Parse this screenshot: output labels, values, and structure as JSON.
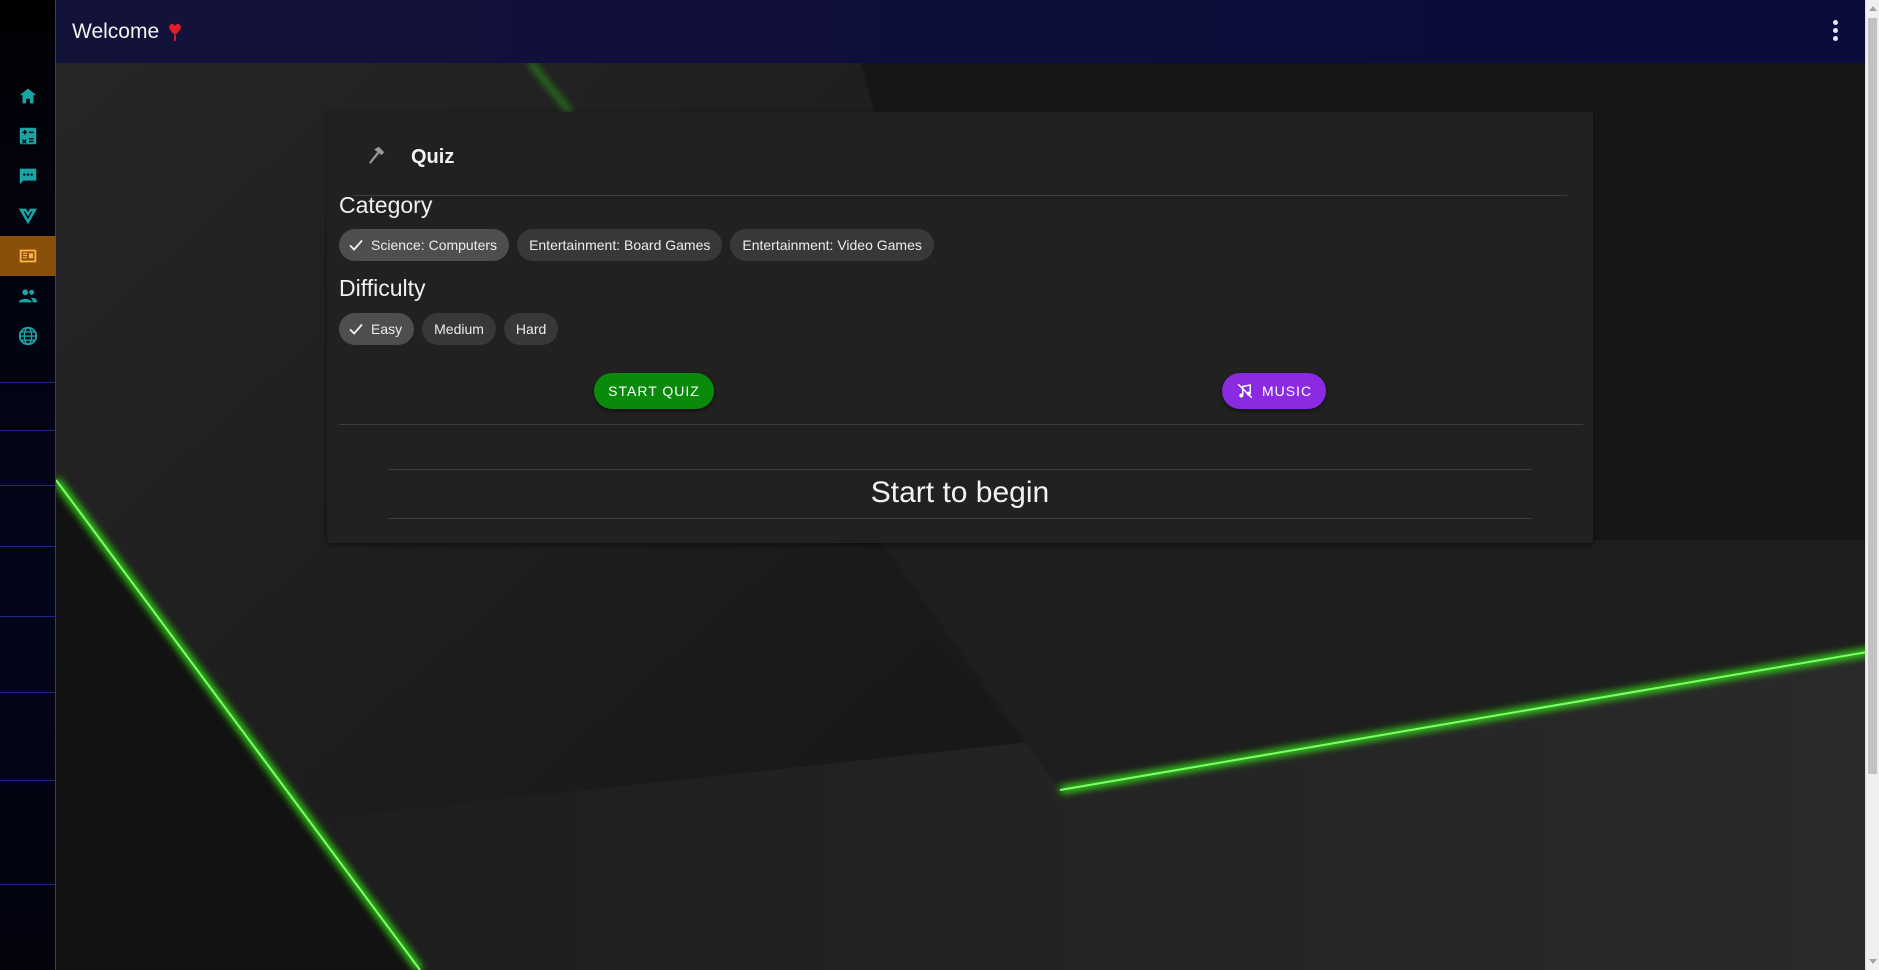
{
  "topbar": {
    "title": "Welcome",
    "heart_icon": "heart-icon",
    "menu_icon": "more-vertical-icon"
  },
  "sidebar": {
    "items": [
      {
        "icon": "home-icon",
        "active": false
      },
      {
        "icon": "calculator-icon",
        "active": false
      },
      {
        "icon": "chat-icon",
        "active": false
      },
      {
        "icon": "vuetify-icon",
        "active": false
      },
      {
        "icon": "quiz-book-icon",
        "active": true
      },
      {
        "icon": "people-icon",
        "active": false
      },
      {
        "icon": "globe-icon",
        "active": false
      }
    ]
  },
  "quiz": {
    "title": "Quiz",
    "category_label": "Category",
    "categories": [
      {
        "label": "Science: Computers",
        "selected": true
      },
      {
        "label": "Entertainment: Board Games",
        "selected": false
      },
      {
        "label": "Entertainment: Video Games",
        "selected": false
      }
    ],
    "difficulty_label": "Difficulty",
    "difficulties": [
      {
        "label": "Easy",
        "selected": true
      },
      {
        "label": "Medium",
        "selected": false
      },
      {
        "label": "Hard",
        "selected": false
      }
    ],
    "start_label": "START QUIZ",
    "music_label": "MUSIC",
    "hint": "Start to begin"
  },
  "colors": {
    "accent_teal": "#1aa5a5",
    "active_nav": "#8a4f0a",
    "start_button": "#0a8a0a",
    "music_button": "#8a2be2",
    "glow_green": "#39ff14"
  }
}
